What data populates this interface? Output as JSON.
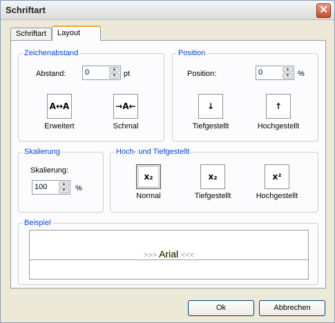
{
  "window": {
    "title": "Schriftart",
    "close_symbol": "✕"
  },
  "tabs": [
    {
      "label": "Schriftart"
    },
    {
      "label": "Layout"
    }
  ],
  "zeichenabstand": {
    "legend": "Zeichenabstand",
    "abstand_label": "Abstand:",
    "abstand_value": "0",
    "abstand_unit": "pt",
    "erweitert_label": "Erweitert",
    "schmal_label": "Schmal"
  },
  "position": {
    "legend": "Position",
    "position_label": "Position:",
    "position_value": "0",
    "position_unit": "%",
    "tief_label": "Tiefgestellt",
    "hoch_label": "Hochgestellt"
  },
  "skalierung": {
    "legend": "Skalierung",
    "skalierung_label": "Skalierung:",
    "skalierung_value": "100",
    "skalierung_unit": "%"
  },
  "hochtief": {
    "legend": "Hoch- und Tiefgestellt",
    "normal_label": "Normal",
    "tief_label": "Tiefgestellt",
    "hoch_label": "Hochgestellt",
    "selected": "Normal"
  },
  "beispiel": {
    "legend": "Beispiel",
    "left_mark": ">>>",
    "font_name": "Arial",
    "right_mark": "<<<"
  },
  "buttons": {
    "ok": "Ok",
    "cancel": "Abbrechen"
  }
}
